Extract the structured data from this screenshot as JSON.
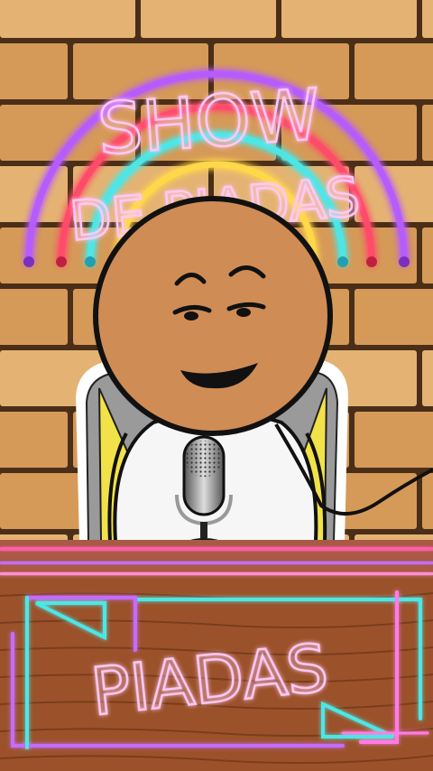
{
  "scene": {
    "sign_line1": "SHOW",
    "sign_line2": "DE PIADAS",
    "desk_sign": "PIADAS"
  },
  "colors": {
    "brick": "#d69a58",
    "brick_light": "#e4b373",
    "mortar": "#5a3a1e",
    "skin": "#d08c55",
    "desk": "#a55a2c",
    "neon_pink": "#ff7ce6",
    "neon_cyan": "#4ee6e6",
    "neon_purple": "#b65cff",
    "neon_red": "#ff4b6a"
  }
}
